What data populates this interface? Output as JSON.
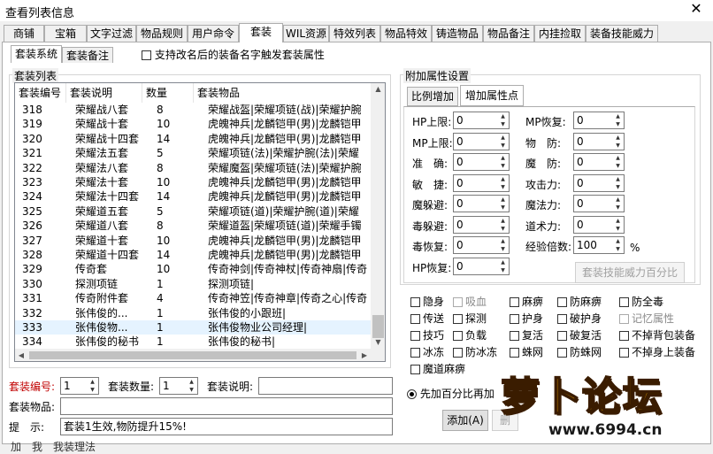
{
  "window": {
    "title": "查看列表信息",
    "close_glyph": "✕"
  },
  "tabs": [
    "商铺",
    "宝箱",
    "文字过滤",
    "物品规则",
    "用户命令",
    "套装",
    "WIL资源",
    "特效列表",
    "物品特效",
    "铸造物品",
    "物品备注",
    "内挂捡取",
    "装备技能威力"
  ],
  "subtabs": [
    "套装系统",
    "套装备注"
  ],
  "rename_trigger_label": "支持改名后的装备名字触发套装属性",
  "list_group_label": "套装列表",
  "columns": [
    "套装编号",
    "套装说明",
    "数量",
    "套装物品"
  ],
  "rows": [
    [
      "318",
      "荣耀战八套",
      "8",
      "荣耀战盔|荣耀项链(战)|荣耀护腕"
    ],
    [
      "319",
      "荣耀战十套",
      "10",
      "虎魄神兵|龙麟铠甲(男)|龙麟铠甲"
    ],
    [
      "320",
      "荣耀战十四套",
      "14",
      "虎魄神兵|龙麟铠甲(男)|龙麟铠甲"
    ],
    [
      "321",
      "荣耀法五套",
      "5",
      "荣耀项链(法)|荣耀护腕(法)|荣耀"
    ],
    [
      "322",
      "荣耀法八套",
      "8",
      "荣耀魔盔|荣耀项链(法)|荣耀护腕"
    ],
    [
      "323",
      "荣耀法十套",
      "10",
      "虎魄神兵|龙麟铠甲(男)|龙麟铠甲"
    ],
    [
      "324",
      "荣耀法十四套",
      "14",
      "虎魄神兵|龙麟铠甲(男)|龙麟铠甲"
    ],
    [
      "325",
      "荣耀道五套",
      "5",
      "荣耀项链(道)|荣耀护腕(道)|荣耀"
    ],
    [
      "326",
      "荣耀道八套",
      "8",
      "荣耀道盔|荣耀项链(道)|荣耀手镯"
    ],
    [
      "327",
      "荣耀道十套",
      "10",
      "虎魄神兵|龙麟铠甲(男)|龙麟铠甲"
    ],
    [
      "328",
      "荣耀道十四套",
      "14",
      "虎魄神兵|龙麟铠甲(男)|龙麟铠甲"
    ],
    [
      "329",
      "传奇套",
      "10",
      "传奇神剑|传奇神杖|传奇神扇|传奇"
    ],
    [
      "330",
      "探测项链",
      "1",
      "探测项链|"
    ],
    [
      "331",
      "传奇附件套",
      "4",
      "传奇神笠|传奇神章|传奇之心|传奇"
    ],
    [
      "332",
      "张伟俊的...",
      "1",
      "张伟俊的小跟班|"
    ],
    [
      "333",
      "张伟俊物...",
      "1",
      "张伟俊物业公司经理|"
    ],
    [
      "334",
      "张伟俊的秘书",
      "1",
      "张伟俊的秘书|"
    ]
  ],
  "form": {
    "suit_no_label": "套装编号:",
    "suit_no_value": "1",
    "suit_count_label": "套装数量:",
    "suit_count_value": "1",
    "suit_desc_label": "套装说明:",
    "suit_desc_value": "",
    "suit_items_label": "套装物品:",
    "suit_items_value": "",
    "hint_label": "提　示:",
    "hint_value": "套装1生效,物防提升15%!",
    "bottom_cut_text": "加　我　我装理法"
  },
  "attr": {
    "group_label": "附加属性设置",
    "tab_ratio": "比例增加",
    "tab_points": "增加属性点",
    "left": [
      {
        "label": "HP上限:",
        "value": "0"
      },
      {
        "label": "MP上限:",
        "value": "0"
      },
      {
        "label": "准　确:",
        "value": "0"
      },
      {
        "label": "敏　捷:",
        "value": "0"
      },
      {
        "label": "魔躲避:",
        "value": "0"
      },
      {
        "label": "毒躲避:",
        "value": "0"
      },
      {
        "label": "毒恢复:",
        "value": "0"
      },
      {
        "label": "HP恢复:",
        "value": "0"
      }
    ],
    "right": [
      {
        "label": "MP恢复:",
        "value": "0"
      },
      {
        "label": "物　防:",
        "value": "0"
      },
      {
        "label": "魔　防:",
        "value": "0"
      },
      {
        "label": "攻击力:",
        "value": "0"
      },
      {
        "label": "魔法力:",
        "value": "0"
      },
      {
        "label": "道术力:",
        "value": "0"
      },
      {
        "label": "经验倍数:",
        "value": "100",
        "unit": "%"
      }
    ],
    "skill_power_button": "套装技能威力百分比"
  },
  "checkboxes": [
    {
      "label": "隐身",
      "enabled": true
    },
    {
      "label": "吸血",
      "enabled": false
    },
    {
      "label": "麻痹",
      "enabled": true
    },
    {
      "label": "防麻痹",
      "enabled": true
    },
    {
      "label": "防全毒",
      "enabled": true
    },
    {
      "label": "传送",
      "enabled": true
    },
    {
      "label": "探测",
      "enabled": true
    },
    {
      "label": "护身",
      "enabled": true
    },
    {
      "label": "破护身",
      "enabled": true
    },
    {
      "label": "记忆属性",
      "enabled": false
    },
    {
      "label": "技巧",
      "enabled": true
    },
    {
      "label": "负载",
      "enabled": true
    },
    {
      "label": "复活",
      "enabled": true
    },
    {
      "label": "破复活",
      "enabled": true
    },
    {
      "label": "不掉背包装备",
      "enabled": true
    },
    {
      "label": "冰冻",
      "enabled": true
    },
    {
      "label": "防冰冻",
      "enabled": true
    },
    {
      "label": "蛛网",
      "enabled": true
    },
    {
      "label": "防蛛网",
      "enabled": true
    },
    {
      "label": "不掉身上装备",
      "enabled": true
    },
    {
      "label": "魔道麻痹",
      "enabled": true
    }
  ],
  "priority_radio_label": "先加百分比再加",
  "buttons": {
    "add": "添加(A)",
    "delete_partial": "删"
  },
  "watermark": {
    "text": "萝卜论坛",
    "url": "www.6994.cn"
  }
}
